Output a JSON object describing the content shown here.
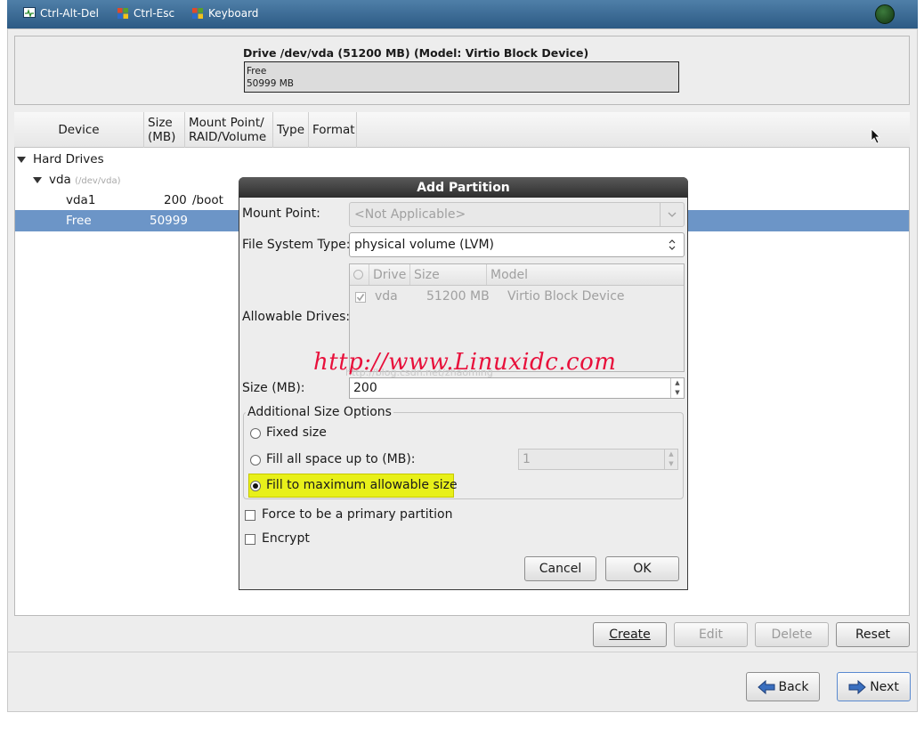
{
  "topbar": {
    "items": [
      "Ctrl-Alt-Del",
      "Ctrl-Esc",
      "Keyboard"
    ]
  },
  "drive": {
    "title": "Drive /dev/vda (51200 MB) (Model: Virtio Block Device)",
    "bar_label": "Free",
    "bar_size": "50999 MB"
  },
  "tree": {
    "headers": {
      "device": "Device",
      "size_line1": "Size",
      "size_line2": "(MB)",
      "mount_line1": "Mount Point/",
      "mount_line2": "RAID/Volume",
      "type": "Type",
      "format": "Format"
    },
    "hard_drives": "Hard Drives",
    "vda": "vda",
    "vda_path": "(/dev/vda)",
    "vda1": "vda1",
    "vda1_size": "200",
    "vda1_mount": "/boot",
    "free": "Free",
    "free_size": "50999"
  },
  "dialog": {
    "title": "Add Partition",
    "mount_point_label": "Mount Point:",
    "mount_point_value": "<Not Applicable>",
    "fs_type_label": "File System Type:",
    "fs_type_value": "physical volume (LVM)",
    "allowable_drives_label": "Allowable Drives:",
    "drives_headers": [
      "Drive",
      "Size",
      "Model"
    ],
    "drives_rows": [
      {
        "drive": "vda",
        "size": "51200 MB",
        "model": "Virtio Block Device",
        "checked": true
      }
    ],
    "size_label": "Size (MB):",
    "size_value": "200",
    "additional_label": "Additional Size Options",
    "opt_fixed": "Fixed size",
    "opt_fill_upto": "Fill all space up to (MB):",
    "fill_upto_value": "1",
    "opt_fill_max": "Fill to maximum allowable size",
    "selected_option": "Fill to maximum allowable size",
    "force_primary": "Force to be a primary partition",
    "encrypt": "Encrypt",
    "cancel": "Cancel",
    "ok": "OK"
  },
  "watermark": {
    "url": "http://www.Linuxidc.com",
    "faint": "http://blog.csdn.net/zhaoming"
  },
  "buttons": {
    "create": "Create",
    "edit": "Edit",
    "delete": "Delete",
    "reset": "Reset",
    "back": "Back",
    "next": "Next"
  },
  "colors": {
    "selection": "#6c95c7",
    "highlight": "#e8f01a",
    "watermark": "#e8103b",
    "topbar": "#2c5a84"
  }
}
